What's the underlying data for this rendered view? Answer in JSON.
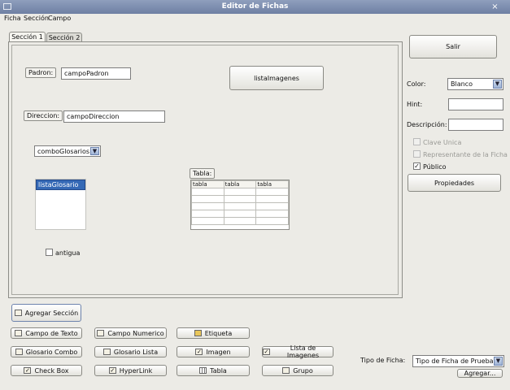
{
  "window": {
    "title": "Editor de Fichas",
    "close_glyph": "×"
  },
  "menu": [
    "Ficha",
    "Sección",
    "Campo"
  ],
  "tabs": [
    "Sección 1",
    "Sección 2"
  ],
  "form": {
    "padron_label": "Padron:",
    "padron_value": "campoPadron",
    "imagenes_button": "listaImagenes",
    "direccion_label": "Direccion:",
    "direccion_value": "campoDireccion",
    "combo_value": "comboGlosarios",
    "list_selected": "listaGlosario",
    "tabla_label": "Tabla:",
    "table_headers": [
      "tabla",
      "tabla",
      "tabla"
    ],
    "antigua_label": "antigua"
  },
  "side": {
    "salir": "Salir",
    "color_label": "Color:",
    "color_value": "Blanco",
    "hint_label": "Hint:",
    "desc_label": "Descripción:",
    "clave_unica": "Clave Unica",
    "representante": "Representante de la Ficha",
    "publico": "Público",
    "propiedades": "Propiedades"
  },
  "toolbar": {
    "agregar_seccion": "Agregar Sección",
    "campo_texto": "Campo de Texto",
    "campo_numerico": "Campo Numerico",
    "etiqueta": "Etiqueta",
    "glosario_combo": "Glosario Combo",
    "glosario_lista": "Glosario Lista",
    "imagen": "Imagen",
    "lista_imagenes": "Lista de Imagenes",
    "check_box": "Check Box",
    "hyperlink": "HyperLink",
    "tabla": "Tabla",
    "grupo": "Grupo"
  },
  "footer": {
    "tipo_label": "Tipo de Ficha:",
    "tipo_value": "Tipo de Ficha de Prueba",
    "agregar": "Agregar..."
  }
}
